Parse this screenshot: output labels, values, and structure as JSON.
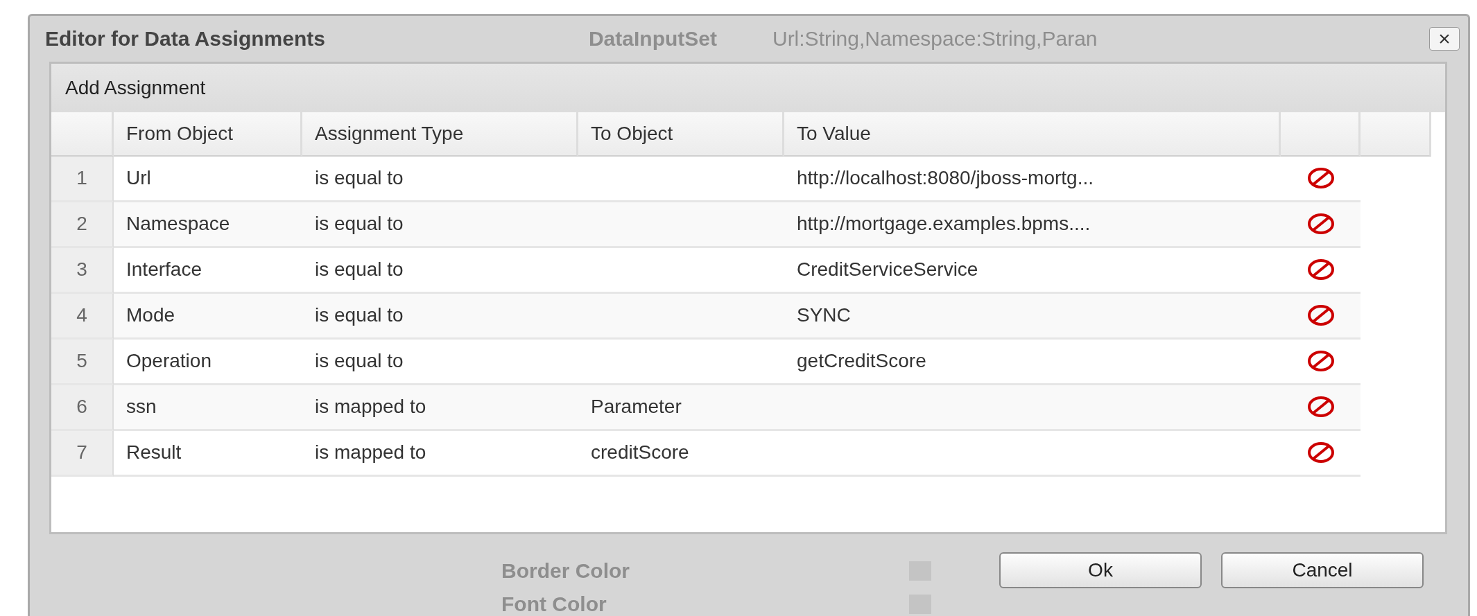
{
  "window": {
    "title": "Editor for Data Assignments",
    "close_label": "×"
  },
  "backdrop": {
    "top_labels": [
      "DataInputSet",
      "Url:String,Namespace:String,Paran"
    ],
    "bottom_labels": [
      "Border Color",
      "Font Color"
    ]
  },
  "panel": {
    "title": "Add Assignment"
  },
  "table": {
    "columns": [
      "From Object",
      "Assignment Type",
      "To Object",
      "To Value"
    ],
    "rows": [
      {
        "index": "1",
        "from": "Url",
        "type": "is equal to",
        "to_object": "",
        "to_value": "http://localhost:8080/jboss-mortg..."
      },
      {
        "index": "2",
        "from": "Namespace",
        "type": "is equal to",
        "to_object": "",
        "to_value": "http://mortgage.examples.bpms...."
      },
      {
        "index": "3",
        "from": "Interface",
        "type": "is equal to",
        "to_object": "",
        "to_value": "CreditServiceService"
      },
      {
        "index": "4",
        "from": "Mode",
        "type": "is equal to",
        "to_object": "",
        "to_value": "SYNC"
      },
      {
        "index": "5",
        "from": "Operation",
        "type": "is equal to",
        "to_object": "",
        "to_value": "getCreditScore"
      },
      {
        "index": "6",
        "from": "ssn",
        "type": "is mapped to",
        "to_object": "Parameter",
        "to_value": ""
      },
      {
        "index": "7",
        "from": "Result",
        "type": "is mapped to",
        "to_object": "creditScore",
        "to_value": ""
      }
    ]
  },
  "buttons": [
    "Ok",
    "Cancel"
  ]
}
